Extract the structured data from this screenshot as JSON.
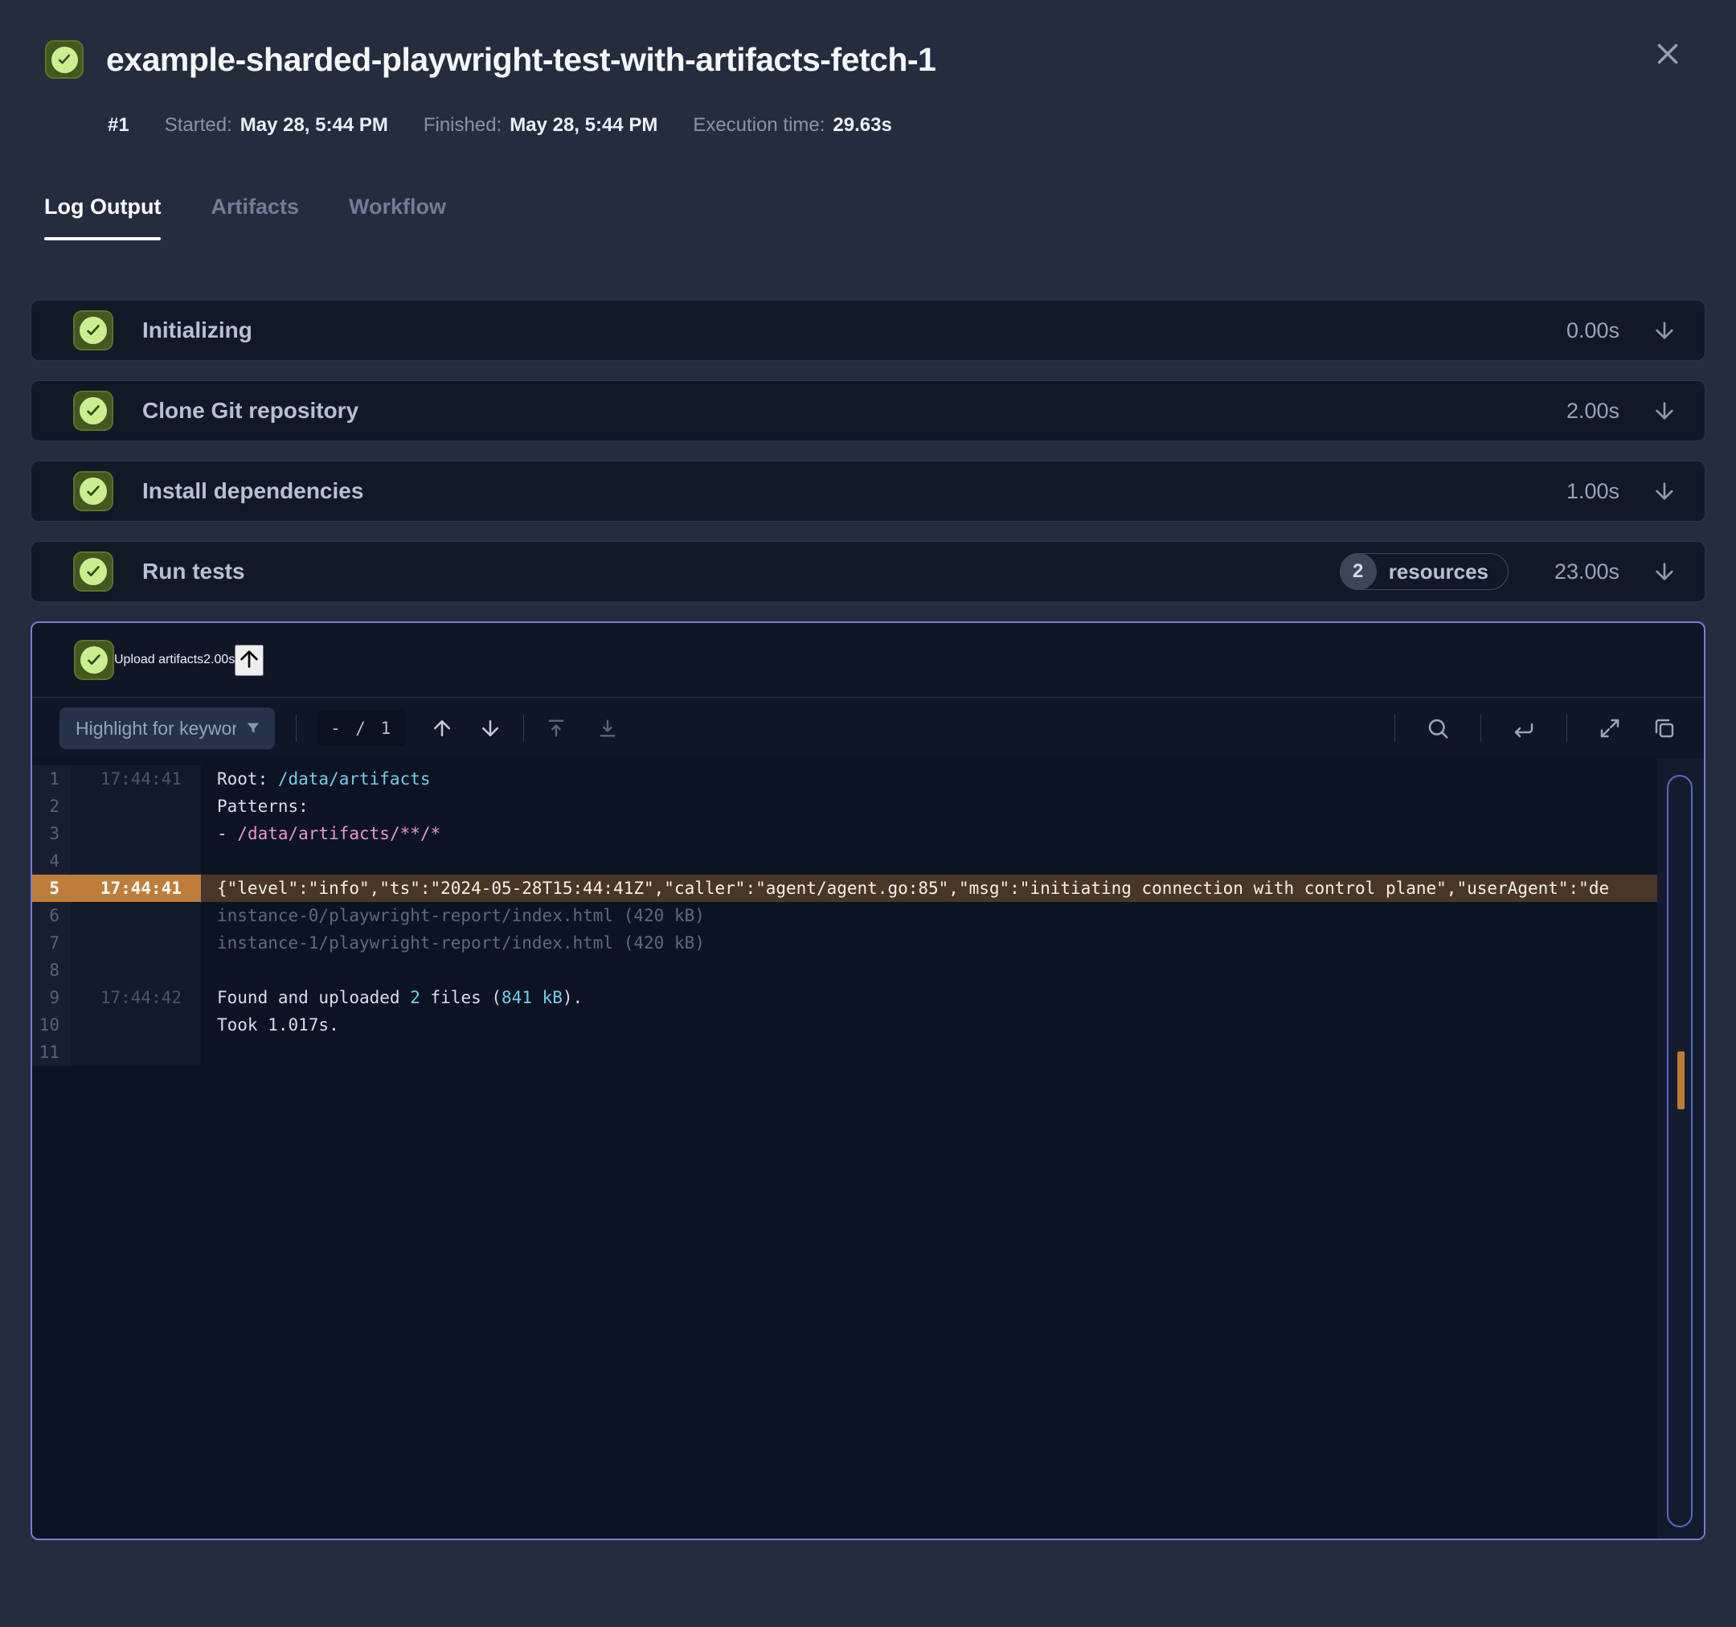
{
  "header": {
    "title": "example-sharded-playwright-test-with-artifacts-fetch-1"
  },
  "meta": {
    "run_number": "#1",
    "started_label": "Started:",
    "started_value": "May 28, 5:44 PM",
    "finished_label": "Finished:",
    "finished_value": "May 28, 5:44 PM",
    "execution_label": "Execution time:",
    "execution_value": "29.63s"
  },
  "tabs": [
    {
      "label": "Log Output",
      "active": true
    },
    {
      "label": "Artifacts",
      "active": false
    },
    {
      "label": "Workflow",
      "active": false
    }
  ],
  "steps": [
    {
      "label": "Initializing",
      "duration": "0.00s"
    },
    {
      "label": "Clone Git repository",
      "duration": "2.00s"
    },
    {
      "label": "Install dependencies",
      "duration": "1.00s"
    },
    {
      "label": "Run tests",
      "duration": "23.00s",
      "badge_count": "2",
      "badge_label": "resources"
    },
    {
      "label": "Upload artifacts",
      "duration": "2.00s"
    }
  ],
  "log_toolbar": {
    "filter_placeholder": "Highlight for keywords",
    "match_counter": "- / 1"
  },
  "log": {
    "lines": [
      {
        "num": "1",
        "time": "17:44:41",
        "segments": [
          {
            "text": "Root: "
          },
          {
            "text": "/data/artifacts",
            "color": "cyan"
          }
        ]
      },
      {
        "num": "2",
        "time": "",
        "segments": [
          {
            "text": "Patterns:"
          }
        ]
      },
      {
        "num": "3",
        "time": "",
        "segments": [
          {
            "text": "- "
          },
          {
            "text": "/data/artifacts/**/*",
            "color": "pink"
          }
        ]
      },
      {
        "num": "4",
        "time": "",
        "segments": []
      },
      {
        "num": "5",
        "time": "17:44:41",
        "highlight": true,
        "segments": [
          {
            "text": "{\"level\":\"info\",\"ts\":\"2024-05-28T15:44:41Z\",\"caller\":\"agent/agent.go:85\",\"msg\":\"initiating connection with control plane\",\"userAgent\":\"de"
          }
        ]
      },
      {
        "num": "6",
        "time": "",
        "segments": [
          {
            "text": "instance-0/playwright-report/index.html (420 kB)",
            "color": "muted"
          }
        ]
      },
      {
        "num": "7",
        "time": "",
        "segments": [
          {
            "text": "instance-1/playwright-report/index.html (420 kB)",
            "color": "muted"
          }
        ]
      },
      {
        "num": "8",
        "time": "",
        "segments": []
      },
      {
        "num": "9",
        "time": "17:44:42",
        "segments": [
          {
            "text": "Found and uploaded "
          },
          {
            "text": "2",
            "color": "cyan"
          },
          {
            "text": " files ("
          },
          {
            "text": "841 kB",
            "color": "cyan"
          },
          {
            "text": ")."
          }
        ]
      },
      {
        "num": "10",
        "time": "",
        "segments": [
          {
            "text": "Took 1.017s."
          }
        ]
      },
      {
        "num": "11",
        "time": "",
        "segments": []
      }
    ]
  },
  "colors": {
    "page_bg": "#232d3e",
    "card_bg": "#111927",
    "expanded_border": "#7580d8",
    "success_chip_bg": "#42581f",
    "success_disc": "#cbef90",
    "highlight_gutter": "#bf7d3c",
    "highlight_text_bg": "#483729",
    "log_cyan": "#76cde5",
    "log_pink": "#e897cc",
    "scroll_thumb_orange": "#bf7a33"
  }
}
